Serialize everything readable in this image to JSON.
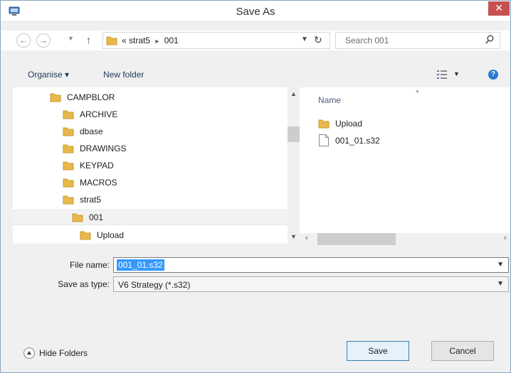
{
  "window": {
    "title": "Save As",
    "close_symbol": "✕"
  },
  "address": {
    "back_icon": "back-arrow-icon",
    "forward_icon": "forward-arrow-icon",
    "up_icon": "up-arrow-icon",
    "breadcrumb_prefix": "«",
    "crumbs": [
      "strat5",
      "001"
    ],
    "search_placeholder": "Search 001"
  },
  "toolbar": {
    "organise_label": "Organise ▾",
    "new_folder_label": "New folder",
    "help_symbol": "?"
  },
  "tree": {
    "items": [
      {
        "label": "CAMPBLOR"
      },
      {
        "label": "ARCHIVE"
      },
      {
        "label": "dbase"
      },
      {
        "label": "DRAWINGS"
      },
      {
        "label": "KEYPAD"
      },
      {
        "label": "MACROS"
      },
      {
        "label": "strat5"
      },
      {
        "label": "001"
      },
      {
        "label": "Upload"
      }
    ],
    "selected": "001"
  },
  "files": {
    "column_name": "Name",
    "items": [
      {
        "label": "Upload",
        "kind": "folder"
      },
      {
        "label": "001_01.s32",
        "kind": "file"
      }
    ]
  },
  "fields": {
    "filename_label": "File name:",
    "filename_value": "001_01.s32",
    "savetype_label": "Save as type:",
    "savetype_value": "V6 Strategy (*.s32)"
  },
  "footer": {
    "hide_folders_label": "Hide Folders",
    "save_label": "Save",
    "cancel_label": "Cancel"
  },
  "colors": {
    "folder": "#e8b94a",
    "close": "#c75050",
    "selection": "#3399ff",
    "link_text": "#1e395b"
  }
}
